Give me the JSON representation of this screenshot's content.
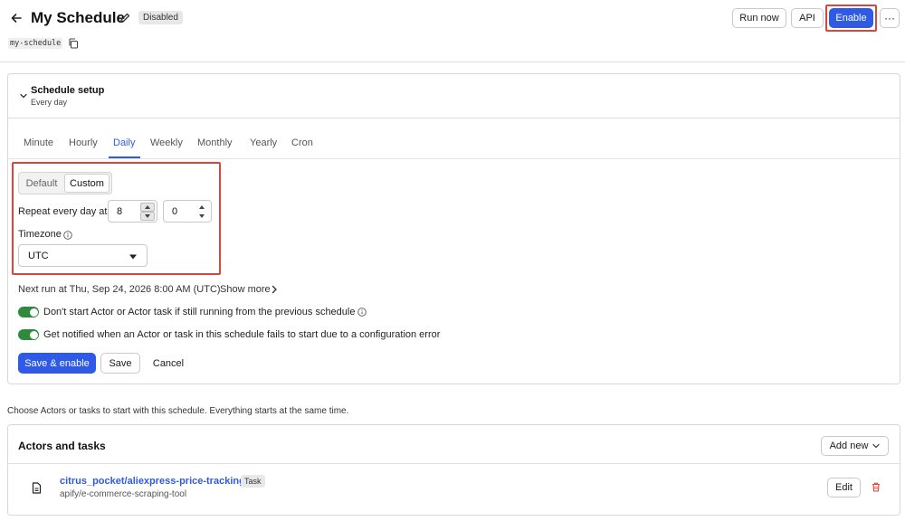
{
  "header": {
    "title": "My Schedule",
    "status": "Disabled",
    "slug": "my-schedule",
    "actions": {
      "run_now": "Run now",
      "api": "API",
      "enable": "Enable",
      "more": "···"
    }
  },
  "schedule_setup": {
    "title": "Schedule setup",
    "subtitle": "Every day",
    "tabs": [
      {
        "label": "Minute"
      },
      {
        "label": "Hourly"
      },
      {
        "label": "Daily",
        "active": true
      },
      {
        "label": "Weekly"
      },
      {
        "label": "Monthly"
      },
      {
        "label": "Yearly"
      },
      {
        "label": "Cron"
      }
    ],
    "mode": {
      "default_label": "Default",
      "custom_label": "Custom",
      "selected": "Custom"
    },
    "repeat_label": "Repeat every day at",
    "hour": "8",
    "minute": "0",
    "timezone_label": "Timezone",
    "timezone": "UTC",
    "next_run": "Next run at Thu, Sep 24, 2026 8:00 AM (UTC)",
    "show_more": "Show more",
    "options": [
      {
        "label": "Don't start Actor or Actor task if still running from the previous schedule",
        "enabled": true
      },
      {
        "label": "Get notified when an Actor or task in this schedule fails to start due to a configuration error",
        "enabled": true
      }
    ],
    "buttons": {
      "save_enable": "Save & enable",
      "save": "Save",
      "cancel": "Cancel"
    }
  },
  "actors": {
    "intro": "Choose Actors or tasks to start with this schedule. Everything starts at the same time.",
    "title": "Actors and tasks",
    "add_new": "Add new",
    "items": [
      {
        "name": "citrus_pocket/aliexpress-price-tracking",
        "badge": "Task",
        "subtitle": "apify/e-commerce-scraping-tool",
        "edit": "Edit"
      }
    ]
  },
  "colors": {
    "primary": "#2e5ae5",
    "toggle_on": "#2f8a3b",
    "highlight": "#d9463a",
    "danger": "#d9463a"
  },
  "icons": [
    "back-arrow-icon",
    "pencil-icon",
    "copy-icon",
    "chevron-down-icon",
    "info-icon",
    "caret-down-icon",
    "chevron-right-icon",
    "document-icon",
    "trash-icon"
  ]
}
